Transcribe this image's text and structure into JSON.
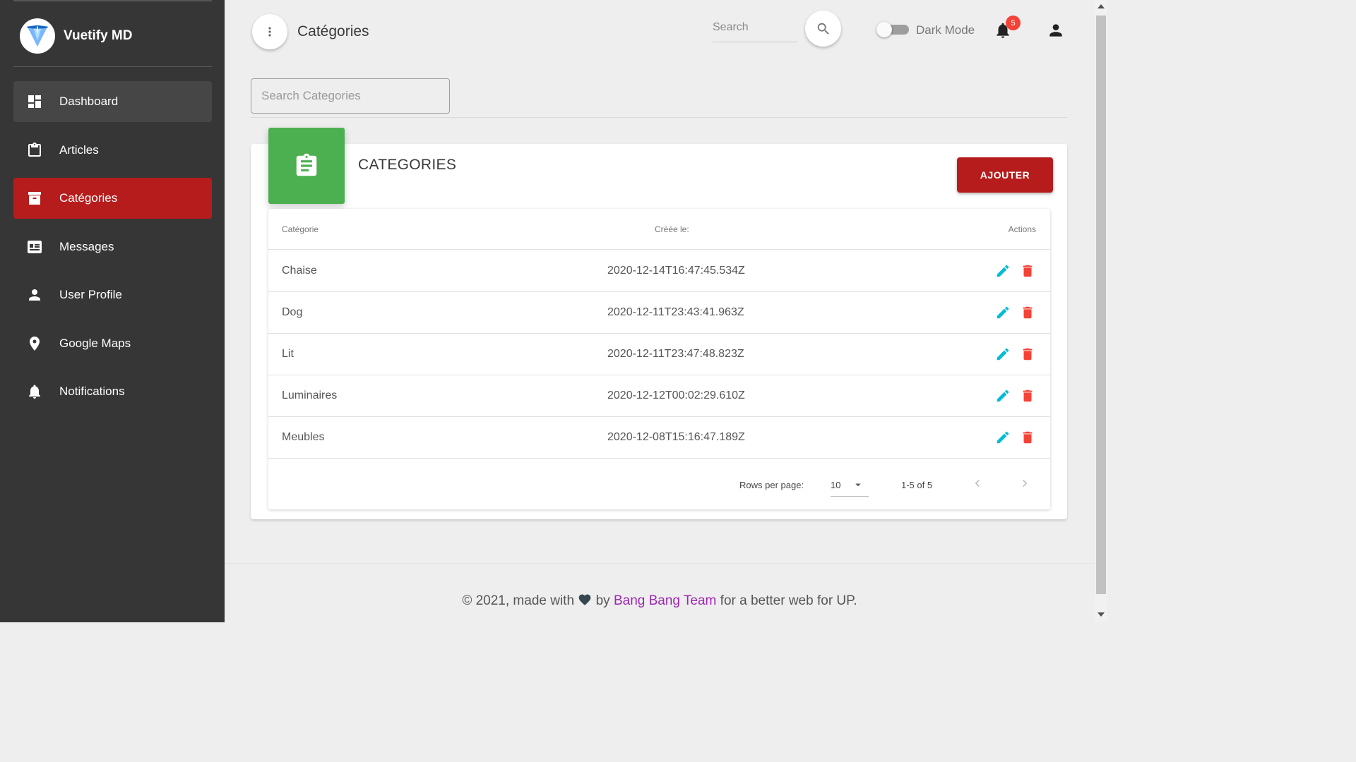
{
  "brand": {
    "name": "Vuetify MD"
  },
  "sidebar": {
    "items": [
      {
        "label": "Dashboard",
        "icon": "dashboard-icon",
        "state": "hover"
      },
      {
        "label": "Articles",
        "icon": "clipboard-icon",
        "state": "normal"
      },
      {
        "label": "Catégories",
        "icon": "archive-icon",
        "state": "active"
      },
      {
        "label": "Messages",
        "icon": "newspaper-icon",
        "state": "normal"
      },
      {
        "label": "User Profile",
        "icon": "person-icon",
        "state": "normal"
      },
      {
        "label": "Google Maps",
        "icon": "map-marker-icon",
        "state": "normal"
      },
      {
        "label": "Notifications",
        "icon": "bell-icon",
        "state": "normal"
      }
    ]
  },
  "header": {
    "title": "Catégories",
    "search_placeholder": "Search",
    "dark_mode_label": "Dark Mode",
    "dark_mode_on": false,
    "notification_count": "5"
  },
  "category_search": {
    "placeholder": "Search Categories"
  },
  "card": {
    "title": "CATEGORIES",
    "add_label": "AJOUTER",
    "icon": "clipboard-text-icon"
  },
  "table": {
    "headers": {
      "category": "Catégorie",
      "created": "Créée le:",
      "actions": "Actions"
    },
    "rows": [
      {
        "name": "Chaise",
        "created": "2020-12-14T16:47:45.534Z"
      },
      {
        "name": "Dog",
        "created": "2020-12-11T23:43:41.963Z"
      },
      {
        "name": "Lit",
        "created": "2020-12-11T23:47:48.823Z"
      },
      {
        "name": "Luminaires",
        "created": "2020-12-12T00:02:29.610Z"
      },
      {
        "name": "Meubles",
        "created": "2020-12-08T15:16:47.189Z"
      }
    ],
    "footer": {
      "rows_per_page_label": "Rows per page:",
      "rows_per_page": "10",
      "range": "1-5 of 5"
    }
  },
  "footer": {
    "prefix": "© 2021, made with",
    "by": "by",
    "team": "Bang Bang Team",
    "suffix": "for a better web for UP."
  },
  "colors": {
    "sidebar_bg": "#363636",
    "active": "#b71c1c",
    "card_icon": "#4caf50",
    "edit": "#00bcd4",
    "delete": "#f44336",
    "team_link": "#9c27b0"
  }
}
